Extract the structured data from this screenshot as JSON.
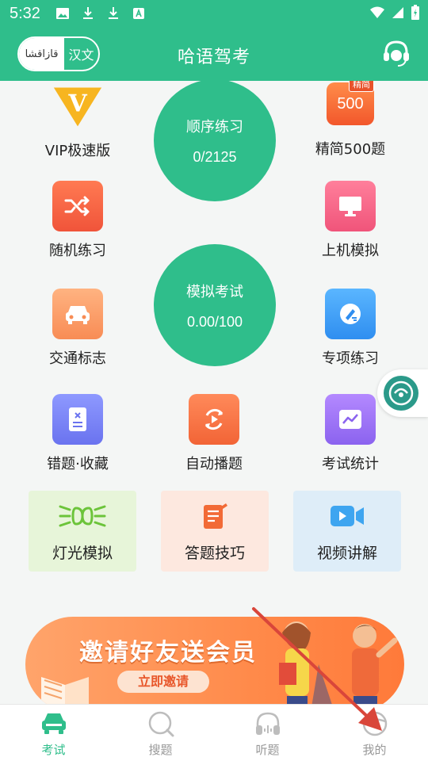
{
  "status_bar": {
    "time": "5:32"
  },
  "header": {
    "lang_left": "قازاقشا",
    "lang_right": "汉文",
    "title": "哈语驾考"
  },
  "grid": {
    "vip": "VIP极速版",
    "order_practice": {
      "title": "顺序练习",
      "value": "0/2125"
    },
    "simple500": {
      "label": "精简500题",
      "tile_text": "500",
      "badge": "精简"
    },
    "random": "随机练习",
    "computer_sim": "上机模拟",
    "mock_exam": {
      "title": "模拟考试",
      "value": "0.00/100"
    },
    "traffic_signs": "交通标志",
    "special": "专项练习",
    "wrong_fav": "错题·收藏",
    "autoplay": "自动播题",
    "stats": "考试统计"
  },
  "cards": {
    "lights": "灯光模拟",
    "tips": "答题技巧",
    "video": "视频讲解"
  },
  "banner": {
    "title": "邀请好友送会员",
    "button": "立即邀请"
  },
  "bottom_nav": {
    "items": [
      {
        "label": "考试",
        "icon": "car-icon",
        "active": true
      },
      {
        "label": "搜题",
        "icon": "search-icon",
        "active": false
      },
      {
        "label": "听题",
        "icon": "headphones-icon",
        "active": false
      },
      {
        "label": "我的",
        "icon": "steering-wheel-icon",
        "active": false
      }
    ]
  },
  "colors": {
    "brand": "#2fbe8b",
    "annotation_arrow": "#d9463a"
  }
}
